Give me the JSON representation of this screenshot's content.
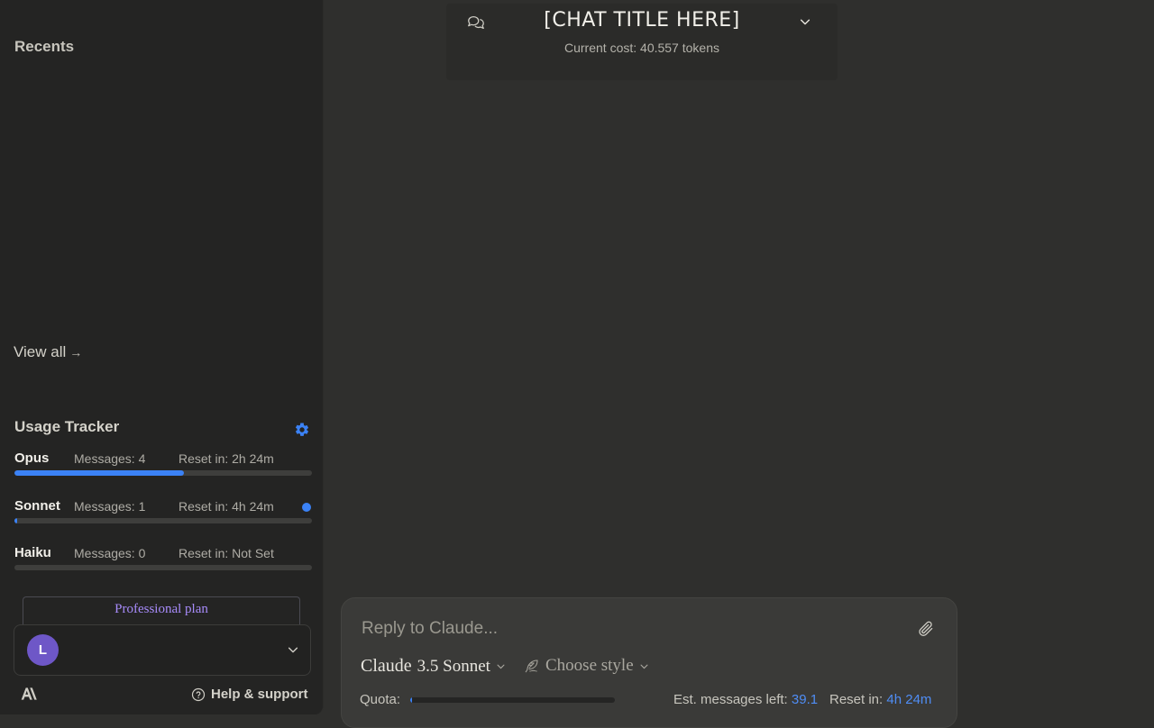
{
  "sidebar": {
    "recents_title": "Recents",
    "view_all": "View all",
    "view_all_arrow": "→",
    "usage_tracker": {
      "title": "Usage Tracker",
      "models": [
        {
          "name": "Opus",
          "messages": "Messages: 4",
          "reset": "Reset in: 2h 24m",
          "progress": 0.57,
          "active": false
        },
        {
          "name": "Sonnet",
          "messages": "Messages: 1",
          "reset": "Reset in: 4h 24m",
          "progress": 0.01,
          "active": true
        },
        {
          "name": "Haiku",
          "messages": "Messages: 0",
          "reset": "Reset in: Not Set",
          "progress": 0,
          "active": false
        }
      ]
    },
    "plan": "Professional plan",
    "user": {
      "avatar_initial": "L"
    },
    "help": "Help & support"
  },
  "header": {
    "chat_title": "[CHAT TITLE HERE]",
    "cost": "Current cost: 40.557 tokens"
  },
  "composer": {
    "placeholder": "Reply to Claude...",
    "model_name": "Claude",
    "model_version": "3.5 Sonnet",
    "style_label": "Choose style",
    "quota_label": "Quota:",
    "quota_progress": 0.01,
    "est_label": "Est. messages left:",
    "est_value": "39.1",
    "reset_label": "Reset in:",
    "reset_value": "4h 24m"
  },
  "colors": {
    "accent": "#3b82f6",
    "plan_text": "#a78bfa",
    "avatar": "#6e57c7",
    "background": "#2f2f2d",
    "sidebar": "#242423"
  }
}
